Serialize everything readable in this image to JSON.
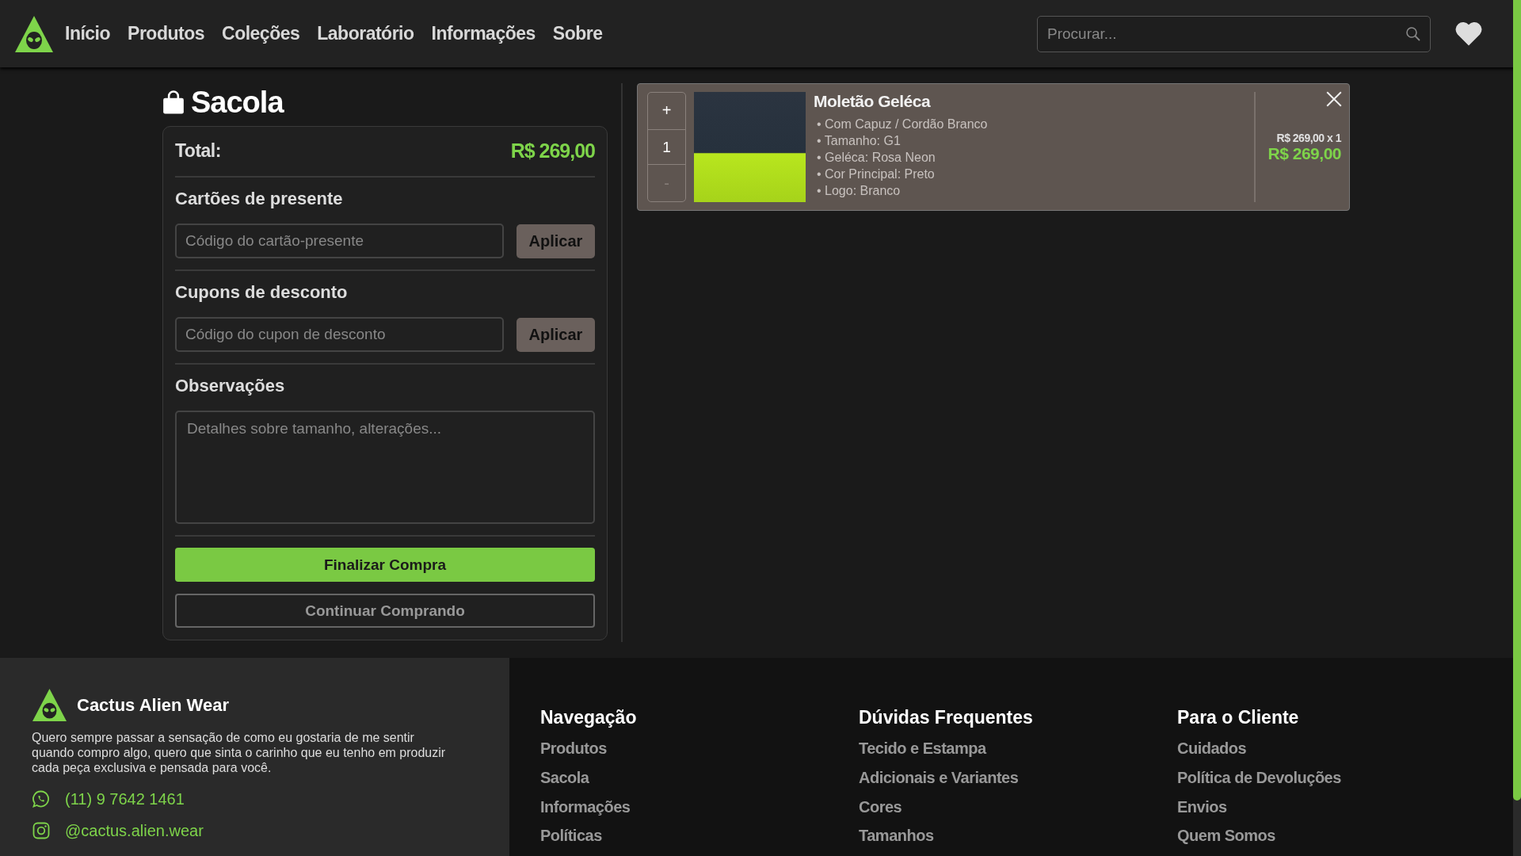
{
  "header": {
    "nav": [
      {
        "label": "Início"
      },
      {
        "label": "Produtos"
      },
      {
        "label": "Coleções"
      },
      {
        "label": "Laboratório"
      },
      {
        "label": "Informações"
      },
      {
        "label": "Sobre"
      }
    ],
    "search": {
      "placeholder": "Procurar..."
    }
  },
  "cart": {
    "title": "Sacola",
    "total_label": "Total:",
    "total_value": "R$ 269,00",
    "gift_cards": {
      "heading": "Cartões de presente",
      "placeholder": "Código do cartão-presente",
      "button": "Aplicar"
    },
    "coupons": {
      "heading": "Cupons de desconto",
      "placeholder": "Código do cupon de desconto",
      "button": "Aplicar"
    },
    "notes": {
      "heading": "Observações",
      "placeholder": "Detalhes sobre tamanho, alterações..."
    },
    "checkout_button": "Finalizar Compra",
    "continue_button": "Continuar Comprando"
  },
  "items": [
    {
      "name": "Moletão Geléca",
      "increase": "+",
      "quantity": "1",
      "decrease": "-",
      "decrease_disabled": true,
      "options": [
        "• Com Capuz / Cordão Branco",
        "• Tamanho: G1",
        "• Geléca: Rosa Neon",
        "• Cor Principal: Preto",
        "• Logo: Branco"
      ],
      "unit_price": "R$ 269,00 x 1",
      "line_total": "R$ 269,00"
    }
  ],
  "footer": {
    "brand": "Cactus Alien Wear",
    "description": "Quero sempre passar a sensação de como eu gostaria de me sentir quando compro algo, quero que sinta o carinho que eu tenho em produzir cada peça exclusiva e pensada para você.",
    "contacts": [
      {
        "kind": "whatsapp",
        "text": "(11) 9 7642 1461"
      },
      {
        "kind": "instagram",
        "text": "@cactus.alien.wear"
      }
    ],
    "columns": [
      {
        "heading": "Navegação",
        "links": [
          "Produtos",
          "Sacola",
          "Informações",
          "Políticas"
        ]
      },
      {
        "heading": "Dúvidas Frequentes",
        "links": [
          "Tecido e Estampa",
          "Adicionais e Variantes",
          "Cores",
          "Tamanhos"
        ]
      },
      {
        "heading": "Para o Cliente",
        "links": [
          "Cuidados",
          "Política de Devoluções",
          "Envios",
          "Quem Somos"
        ]
      }
    ]
  }
}
